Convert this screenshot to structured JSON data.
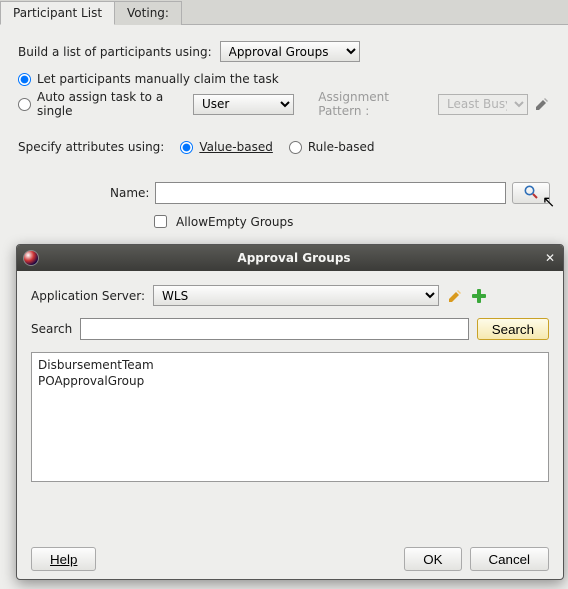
{
  "tabs": {
    "participant_list": "Participant List",
    "voting": "Voting:"
  },
  "build_list_label": "Build a list of participants using:",
  "build_list_value": "Approval Groups",
  "radios": {
    "manual": "Let participants manually claim the task",
    "auto": "Auto assign task to a single"
  },
  "auto_select_value": "User",
  "assignment_pattern_label": "Assignment Pattern :",
  "assignment_pattern_value": "Least Busy",
  "specify_attr_label": "Specify attributes using:",
  "attr_radios": {
    "value_based": "Value-based",
    "rule_based": "Rule-based"
  },
  "name_label": "Name:",
  "name_value": "",
  "allow_empty_label": "AllowEmpty Groups",
  "dialog": {
    "title": "Approval Groups",
    "app_server_label": "Application Server:",
    "app_server_value": "WLS",
    "search_label": "Search",
    "search_value": "",
    "search_button": "Search",
    "results": [
      "DisbursementTeam",
      "POApprovalGroup"
    ],
    "help": "Help",
    "ok": "OK",
    "cancel": "Cancel"
  },
  "icons": {
    "search": "search-icon",
    "pencil": "pencil-icon",
    "plus": "plus-icon",
    "close": "close-icon",
    "app": "app-icon"
  }
}
